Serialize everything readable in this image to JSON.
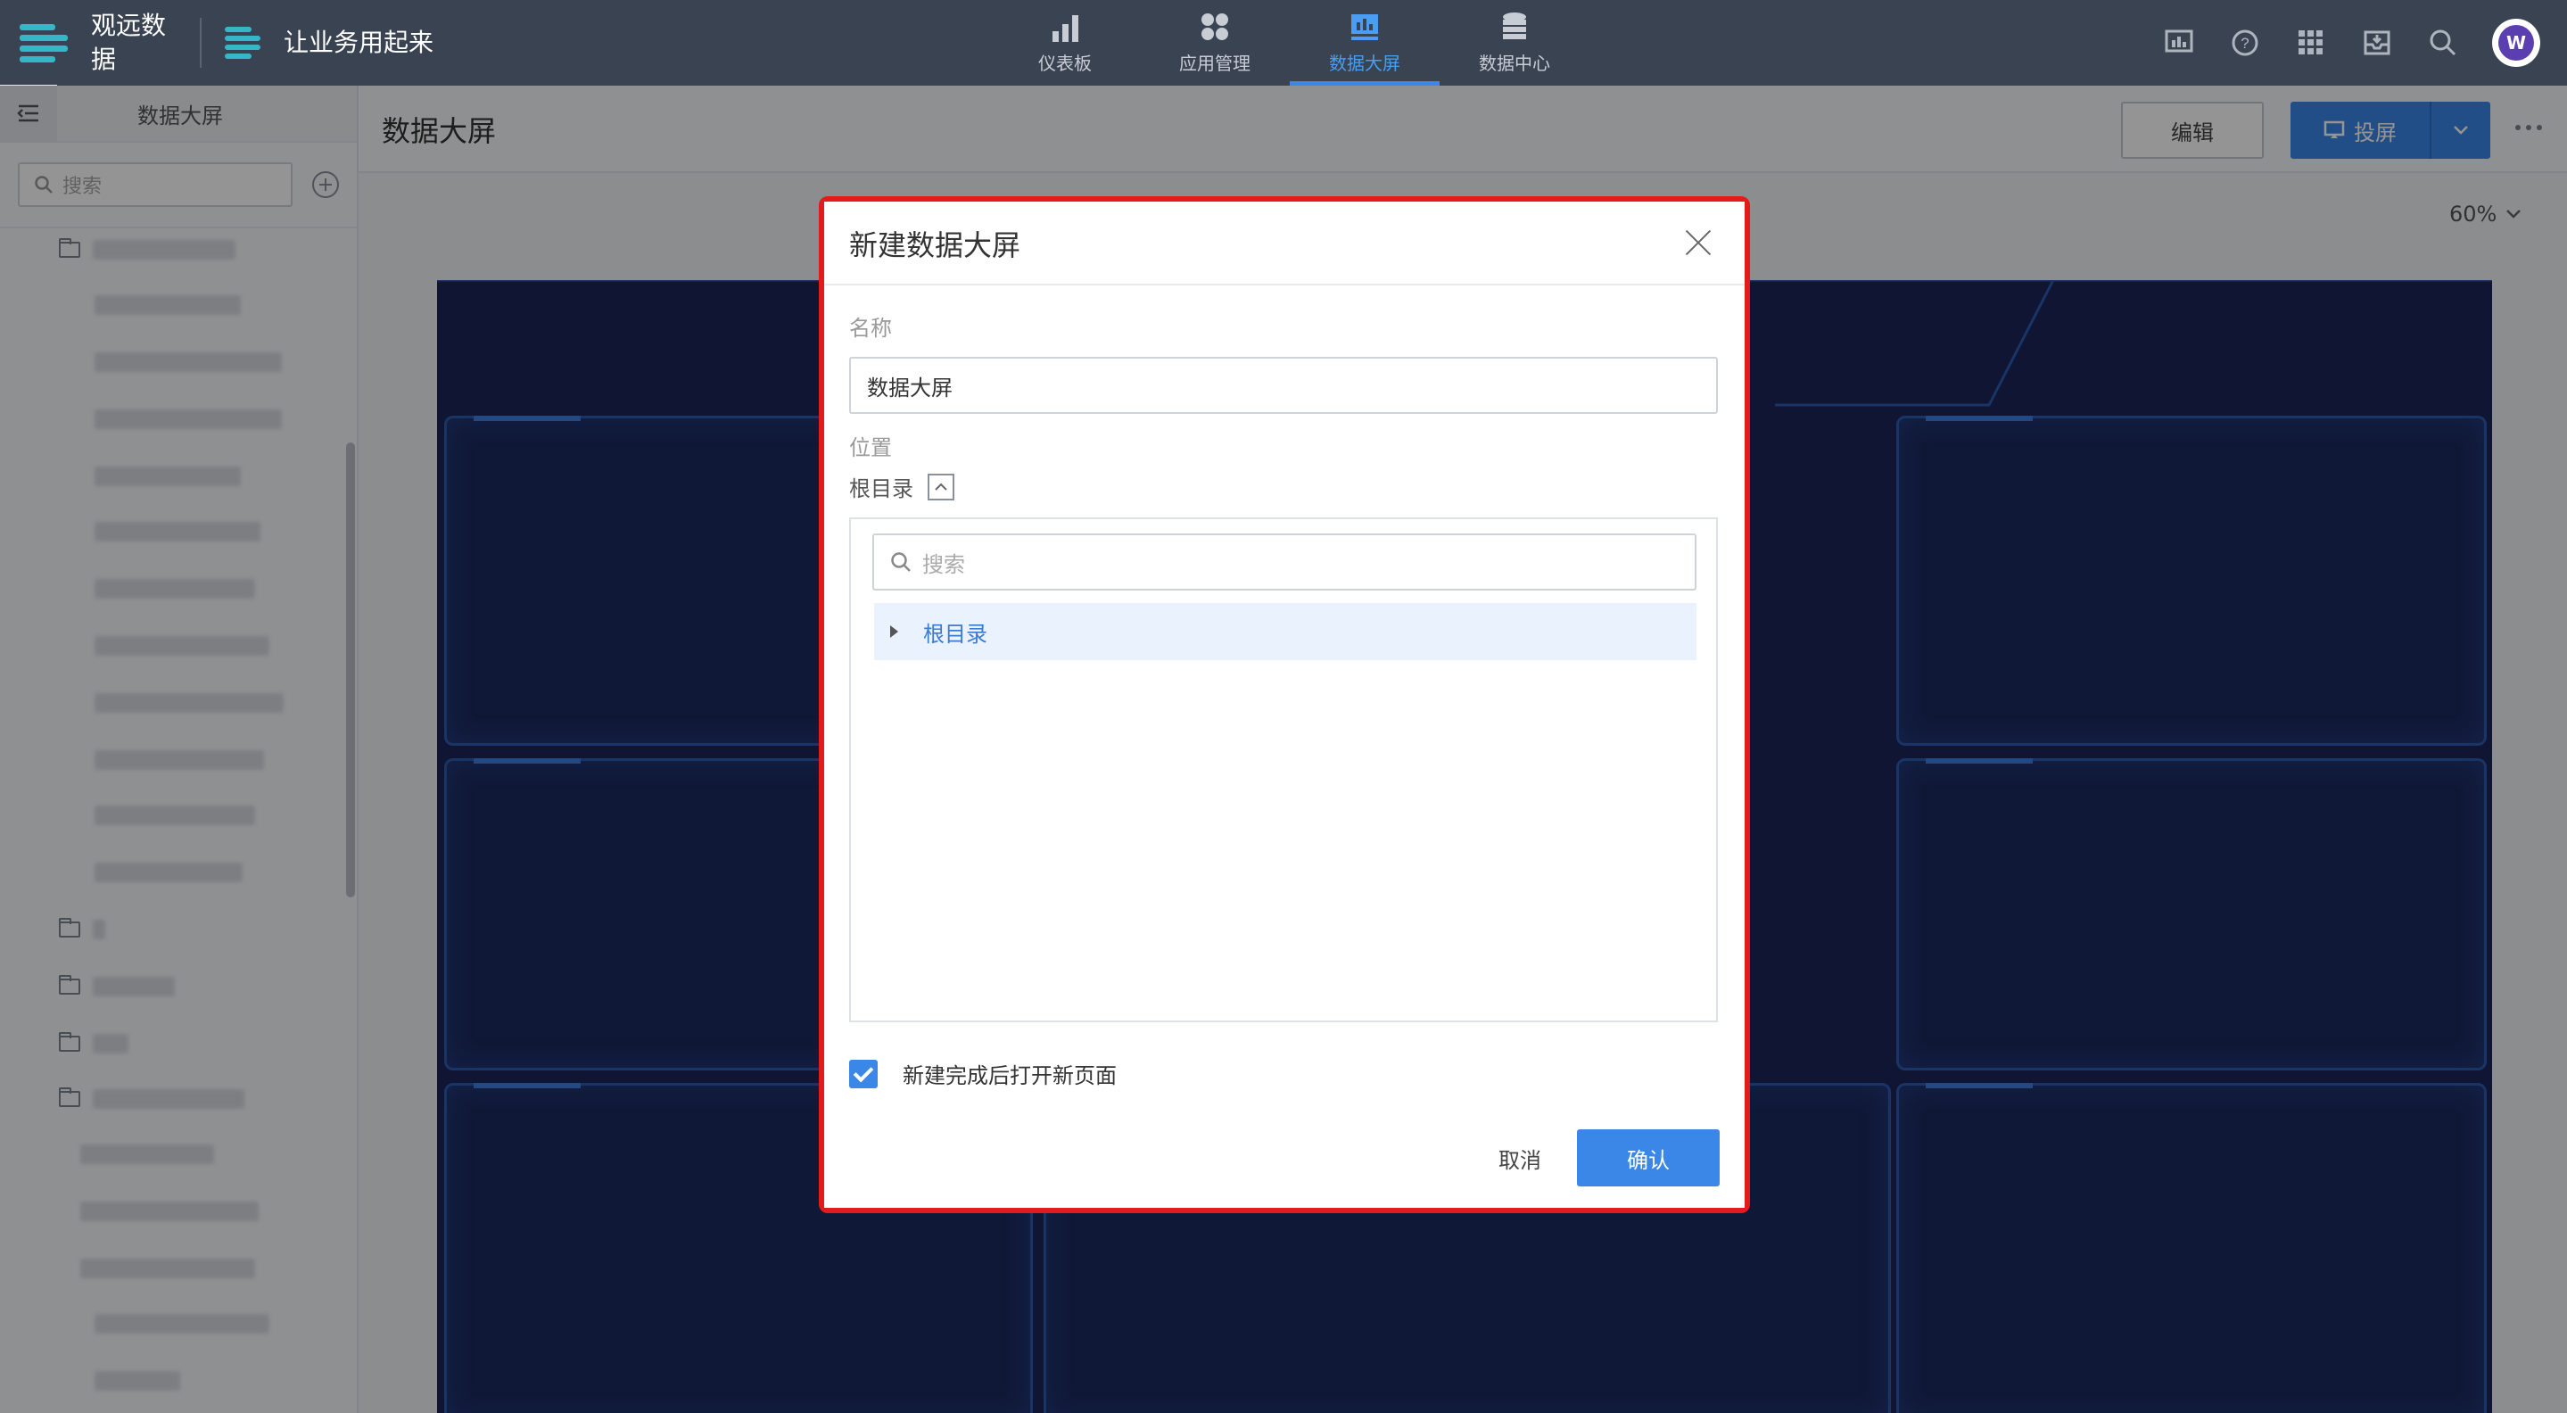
{
  "brand": {
    "name": "观远数据",
    "slogan": "让业务用起来"
  },
  "nav": {
    "items": [
      {
        "label": "仪表板",
        "icon": "bar-chart-icon"
      },
      {
        "label": "应用管理",
        "icon": "apps-grid-icon"
      },
      {
        "label": "数据大屏",
        "icon": "data-screen-icon",
        "active": true
      },
      {
        "label": "数据中心",
        "icon": "database-icon"
      }
    ]
  },
  "toolbar_icons": [
    "screen-monitor-icon",
    "help-icon",
    "grid-menu-icon",
    "inbox-icon",
    "search-icon"
  ],
  "user": {
    "avatar_initial": "W"
  },
  "sidebar": {
    "title": "数据大屏",
    "search_placeholder": "搜索"
  },
  "page": {
    "title": "数据大屏",
    "edit_label": "编辑",
    "present_label": "投屏",
    "zoom": "60%"
  },
  "dialog": {
    "title": "新建数据大屏",
    "name_label": "名称",
    "name_value": "数据大屏",
    "location_label": "位置",
    "location_path": "根目录",
    "tree_search_placeholder": "搜索",
    "tree_root": "根目录",
    "open_after_create_label": "新建完成后打开新页面",
    "open_after_create_checked": true,
    "cancel_label": "取消",
    "confirm_label": "确认"
  },
  "colors": {
    "accent": "#3b87e8",
    "topbar": "#3a4352",
    "brand": "#35b7c8",
    "highlight_outline": "#e31b1b"
  }
}
